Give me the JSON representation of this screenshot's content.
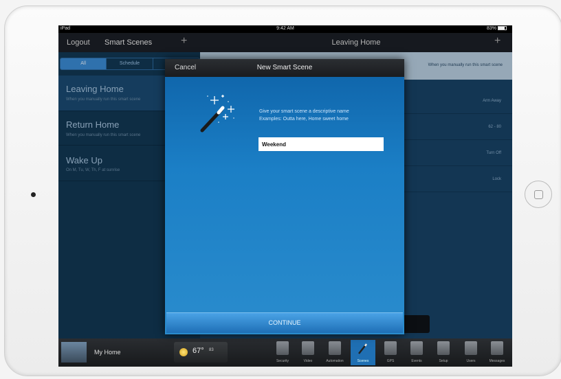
{
  "status_bar": {
    "carrier": "iPad",
    "time": "9:42 AM",
    "battery": "83%"
  },
  "left_nav": {
    "logout_label": "Logout",
    "title": "Smart Scenes",
    "add_glyph": "+"
  },
  "segments": [
    {
      "label": "All",
      "active": true
    },
    {
      "label": "Schedule",
      "active": false
    },
    {
      "label": "",
      "active": false
    }
  ],
  "scenes": [
    {
      "name": "Leaving Home",
      "desc": "When you manually run this smart scene"
    },
    {
      "name": "Return Home",
      "desc": "When you manually run this smart scene"
    },
    {
      "name": "Wake Up",
      "desc": "On M, Tu, W, Th, F at sunrise"
    }
  ],
  "right_nav": {
    "title": "Leaving Home",
    "add_glyph": "+"
  },
  "right_banner": "When you manually run this smart scene",
  "right_rows": [
    "Arm Away",
    "62 - 80",
    "Turn Off",
    "Lock"
  ],
  "modal": {
    "cancel_label": "Cancel",
    "title": "New Smart Scene",
    "prompt_line1": "Give your smart scene a descriptive name",
    "prompt_line2": "Examples: Outta here, Home sweet home",
    "name_value": "Weekend",
    "continue_label": "CONTINUE",
    "icon": "magic-wand-icon"
  },
  "tabbar": {
    "home_label": "My Home",
    "temperature": "67°",
    "temperature_detail": "83",
    "tabs": [
      {
        "label": "Security",
        "icon": "house-icon",
        "active": false
      },
      {
        "label": "Video",
        "icon": "camera-icon",
        "active": false
      },
      {
        "label": "Automation",
        "icon": "automation-icon",
        "active": false
      },
      {
        "label": "Scenes",
        "icon": "magic-wand-icon",
        "active": true
      },
      {
        "label": "GPS",
        "icon": "gps-icon",
        "active": false
      },
      {
        "label": "Events",
        "icon": "alert-icon",
        "active": false
      },
      {
        "label": "Setup",
        "icon": "gear-icon",
        "active": false
      },
      {
        "label": "Users",
        "icon": "users-icon",
        "active": false
      },
      {
        "label": "Messages",
        "icon": "mail-icon",
        "active": false
      }
    ]
  },
  "colors": {
    "accent": "#1b7fc6",
    "nav_dark": "#1b1f26",
    "active_tab": "#1f6fb3"
  }
}
